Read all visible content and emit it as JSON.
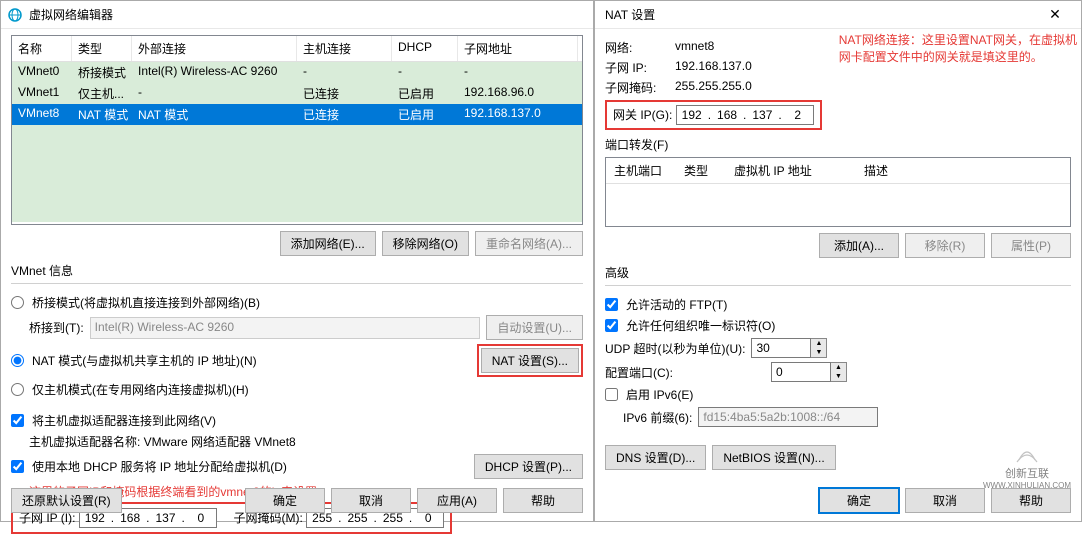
{
  "left": {
    "title": "虚拟网络编辑器",
    "table": {
      "headers": [
        "名称",
        "类型",
        "外部连接",
        "主机连接",
        "DHCP",
        "子网地址"
      ],
      "rows": [
        {
          "name": "VMnet0",
          "type": "桥接模式",
          "ext": "Intel(R) Wireless-AC 9260",
          "host": "-",
          "dhcp": "-",
          "subnet": "-"
        },
        {
          "name": "VMnet1",
          "type": "仅主机...",
          "ext": "-",
          "host": "已连接",
          "dhcp": "已启用",
          "subnet": "192.168.96.0"
        },
        {
          "name": "VMnet8",
          "type": "NAT 模式",
          "ext": "NAT 模式",
          "host": "已连接",
          "dhcp": "已启用",
          "subnet": "192.168.137.0"
        }
      ]
    },
    "buttons": {
      "add": "添加网络(E)...",
      "remove": "移除网络(O)",
      "rename": "重命名网络(A)..."
    },
    "vmnet_info": "VMnet 信息",
    "bridge_radio": "桥接模式(将虚拟机直接连接到外部网络)(B)",
    "bridge_to": "桥接到(T):",
    "bridge_adapter": "Intel(R) Wireless-AC 9260",
    "auto_set": "自动设置(U)...",
    "nat_radio": "NAT 模式(与虚拟机共享主机的 IP 地址)(N)",
    "nat_settings": "NAT 设置(S)...",
    "hostonly_radio": "仅主机模式(在专用网络内连接虚拟机)(H)",
    "host_adapter_check": "将主机虚拟适配器连接到此网络(V)",
    "host_adapter_label": "主机虚拟适配器名称: VMware 网络适配器 VMnet8",
    "dhcp_check": "使用本地 DHCP 服务将 IP 地址分配给虚拟机(D)",
    "dhcp_settings": "DHCP 设置(P)...",
    "red_note": "这里的子网IP和掩码根据终端看到的vmnet8的ip来设置",
    "subnet_ip_label": "子网 IP (I):",
    "subnet_ip": [
      "192",
      "168",
      "137",
      "0"
    ],
    "subnet_mask_label": "子网掩码(M):",
    "subnet_mask": [
      "255",
      "255",
      "255",
      "0"
    ],
    "restore": "还原默认设置(R)",
    "ok": "确定",
    "cancel": "取消",
    "apply": "应用(A)",
    "help": "帮助"
  },
  "right": {
    "title": "NAT 设置",
    "net_label": "网络:",
    "net_val": "vmnet8",
    "subnet_label": "子网 IP:",
    "subnet_val": "192.168.137.0",
    "mask_label": "子网掩码:",
    "mask_val": "255.255.255.0",
    "red_annot1": "NAT网络连接：这里设置NAT网关，在虚拟机",
    "red_annot2": "网卡配置文件中的网关就是填这里的。",
    "gateway_label": "网关 IP(G):",
    "gateway_ip": [
      "192",
      "168",
      "137",
      "2"
    ],
    "port_fwd": "端口转发(F)",
    "pf_headers": [
      "主机端口",
      "类型",
      "虚拟机 IP 地址",
      "描述"
    ],
    "add": "添加(A)...",
    "remove": "移除(R)",
    "props": "属性(P)",
    "advanced": "高级",
    "allow_ftp": "允许活动的 FTP(T)",
    "allow_org": "允许任何组织唯一标识符(O)",
    "udp_timeout": "UDP 超时(以秒为单位)(U):",
    "udp_val": "30",
    "config_port": "配置端口(C):",
    "config_port_val": "0",
    "ipv6_check": "启用 IPv6(E)",
    "ipv6_prefix": "IPv6 前缀(6):",
    "ipv6_val": "fd15:4ba5:5a2b:1008::/64",
    "dns_btn": "DNS 设置(D)...",
    "netbios_btn": "NetBIOS 设置(N)...",
    "ok": "确定",
    "cancel": "取消",
    "help": "帮助",
    "watermark1": "创新互联",
    "watermark2": "WWW.XINHULIAN.COM"
  }
}
